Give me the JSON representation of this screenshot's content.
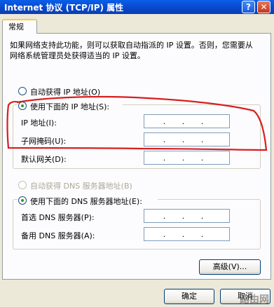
{
  "window": {
    "title": "Internet 协议 (TCP/IP) 属性",
    "help_glyph": "?",
    "close_glyph": "✕"
  },
  "tab": {
    "label": "常规"
  },
  "description": "如果网络支持此功能，则可以获取自动指派的 IP 设置。否则，您需要从网络系统管理员处获得适当的 IP 设置。",
  "ip_section": {
    "auto_label": "自动获得 IP 地址(O)",
    "manual_label": "使用下面的 IP 地址(S):",
    "fields": [
      {
        "label": "IP 地址(I):",
        "value": " .   .   . "
      },
      {
        "label": "子网掩码(U):",
        "value": " .   .   . "
      },
      {
        "label": "默认网关(D):",
        "value": " .   .   . "
      }
    ]
  },
  "dns_section": {
    "auto_label": "自动获得 DNS 服务器地址(B)",
    "manual_label": "使用下面的 DNS 服务器地址(E):",
    "fields": [
      {
        "label": "首选 DNS 服务器(P):",
        "value": " .   .   . "
      },
      {
        "label": "备用 DNS 服务器(A):",
        "value": " .   .   . "
      }
    ]
  },
  "buttons": {
    "advanced": "高级(V)...",
    "ok": "确定",
    "cancel": "取消"
  },
  "watermark": "路由网",
  "colors": {
    "title_bar": "#0A5FE8",
    "annotation": "#D81E1E",
    "selected_radio": "#21A121"
  }
}
